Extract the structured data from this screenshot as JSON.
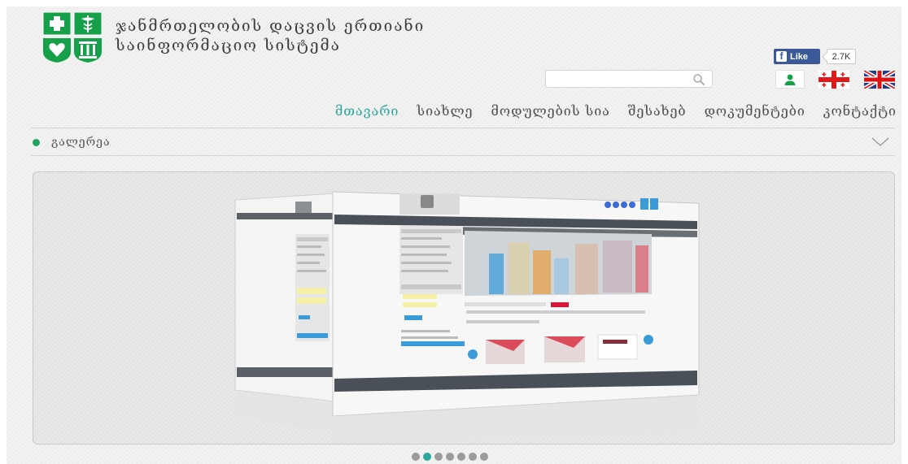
{
  "header": {
    "title_line1": "ჯანმრთელობის დაცვის ერთიანი",
    "title_line2": "საინფორმაციო სისტემა",
    "fb_like_label": "Like",
    "fb_like_count": "2.7K",
    "search": {
      "value": "",
      "placeholder": ""
    },
    "icons": [
      "logo-emblem",
      "search-icon",
      "user-icon",
      "georgian-flag-icon",
      "uk-flag-icon",
      "facebook-icon"
    ]
  },
  "nav": {
    "items": [
      "მთავარი",
      "სიახლე",
      "მოდულების სია",
      "შესახებ",
      "დოკუმენტები",
      "კონტაქტი"
    ],
    "active_index": 0
  },
  "gallery": {
    "label": "გალერეა",
    "slide_count": 7,
    "active_slide": 1
  },
  "colors": {
    "accent": "#2aa69a",
    "logo_green": "#1a9a4a",
    "dot_green": "#1fa55a",
    "fb_blue": "#3b5998"
  }
}
